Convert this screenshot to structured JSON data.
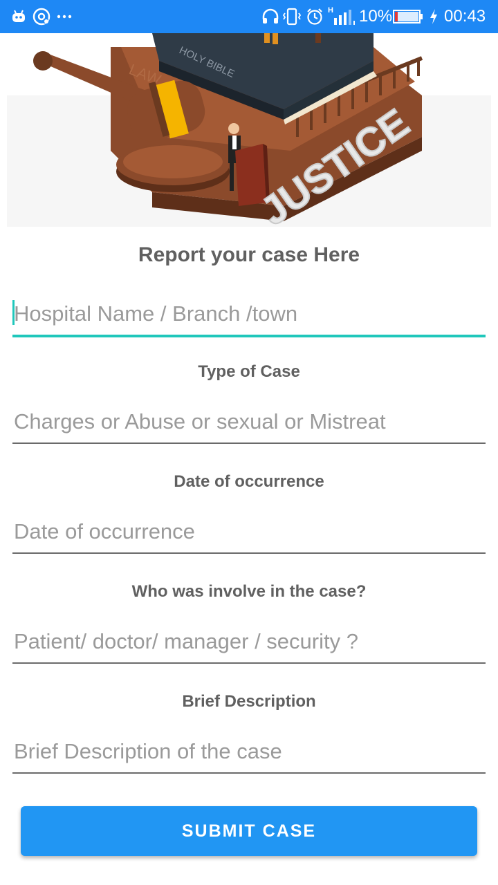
{
  "status_bar": {
    "battery_percent": "10%",
    "time": "00:43",
    "network_type": "H",
    "icons": [
      "android-icon",
      "sync-icon",
      "more-dots-icon",
      "headphones-icon",
      "vibrate-icon",
      "alarm-icon",
      "signal-icon",
      "battery-icon",
      "charging-icon"
    ]
  },
  "hero": {
    "book_text": "HOLY BIBLE",
    "law_text": "LAW",
    "justice_text": "JUSTICE"
  },
  "form": {
    "title": "Report your case Here",
    "fields": [
      {
        "label": "",
        "placeholder": "Hospital Name / Branch /town",
        "value": ""
      },
      {
        "label": "Type of Case",
        "placeholder": "Charges or Abuse or sexual or Mistreat",
        "value": ""
      },
      {
        "label": "Date of occurrence",
        "placeholder": "Date of occurrence",
        "value": ""
      },
      {
        "label": "Who was involve in the case?",
        "placeholder": "Patient/ doctor/ manager / security ?",
        "value": ""
      },
      {
        "label": "Brief Description",
        "placeholder": "Brief Description of the case",
        "value": ""
      }
    ],
    "submit_label": "SUBMIT CASE"
  },
  "colors": {
    "status_bar": "#1e88f5",
    "accent": "#1fc7bb",
    "button": "#2196f3",
    "label_text": "#606060",
    "placeholder_text": "#9a9a9a"
  }
}
